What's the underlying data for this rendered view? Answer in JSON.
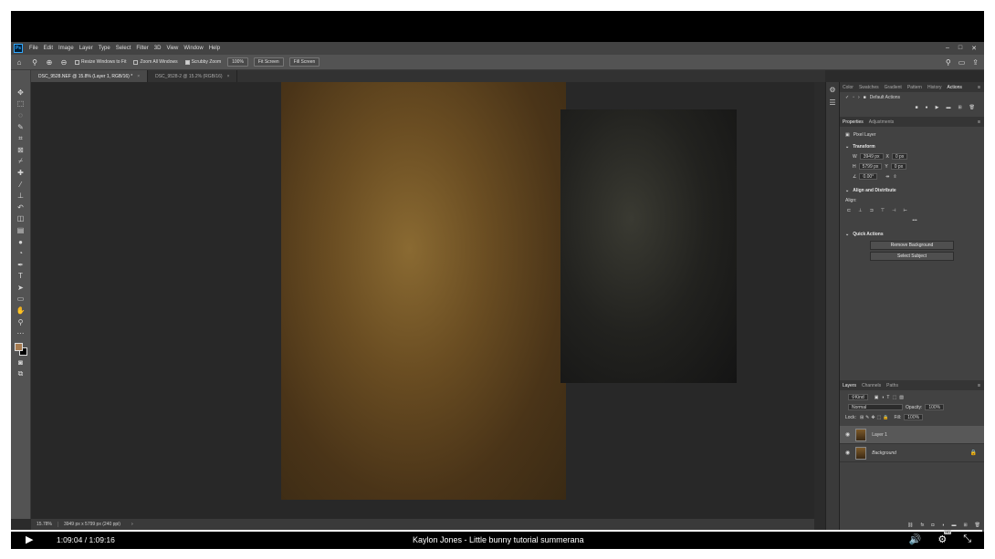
{
  "menu": [
    "File",
    "Edit",
    "Image",
    "Layer",
    "Type",
    "Select",
    "Filter",
    "3D",
    "View",
    "Window",
    "Help"
  ],
  "options": {
    "resize_windows": "Resize Windows to Fit",
    "zoom_all": "Zoom All Windows",
    "scrubby_zoom": "Scrubby Zoom",
    "zoom_pct": "100%",
    "fit_screen": "Fit Screen",
    "fill_screen": "Fill Screen"
  },
  "tabs": [
    {
      "label": "DSC_9528.NEF @ 15.8% (Layer 1, RGB/16) *"
    },
    {
      "label": "DSC_9528-2 @ 15.2% (RGB/16)"
    }
  ],
  "status": {
    "zoom": "15.78%",
    "doc_size": "3949 px x 5799 px (240 ppi)"
  },
  "panels": {
    "top_tabs": [
      "Color",
      "Swatches",
      "Gradient",
      "Pattern",
      "History",
      "Actions"
    ],
    "actions_set": "Default Actions",
    "props_tabs": [
      "Properties",
      "Adjustments"
    ],
    "pixel_layer": "Pixel Layer",
    "transform": "Transform",
    "w_label": "W",
    "w_value": "3949 px",
    "x_label": "X",
    "x_value": "0 px",
    "h_label": "H",
    "h_value": "5799 px",
    "y_label": "Y",
    "y_value": "0 px",
    "angle_value": "0.00°",
    "align_distribute": "Align and Distribute",
    "align_label": "Align:",
    "quick_actions": "Quick Actions",
    "remove_bg": "Remove Background",
    "select_subject": "Select Subject",
    "layer_tabs": [
      "Layers",
      "Channels",
      "Paths"
    ],
    "kind": "Kind",
    "blend_mode": "Normal",
    "opacity_label": "Opacity:",
    "opacity_value": "100%",
    "lock_label": "Lock:",
    "fill_label": "Fill:",
    "fill_value": "100%",
    "layers": [
      {
        "name": "Layer 1",
        "selected": true
      },
      {
        "name": "Background",
        "selected": false
      }
    ]
  },
  "video": {
    "time": "1:09:04 / 1:09:16",
    "title": "Kaylon Jones - Little bunny tutorial summerana",
    "progress": 0.998
  }
}
